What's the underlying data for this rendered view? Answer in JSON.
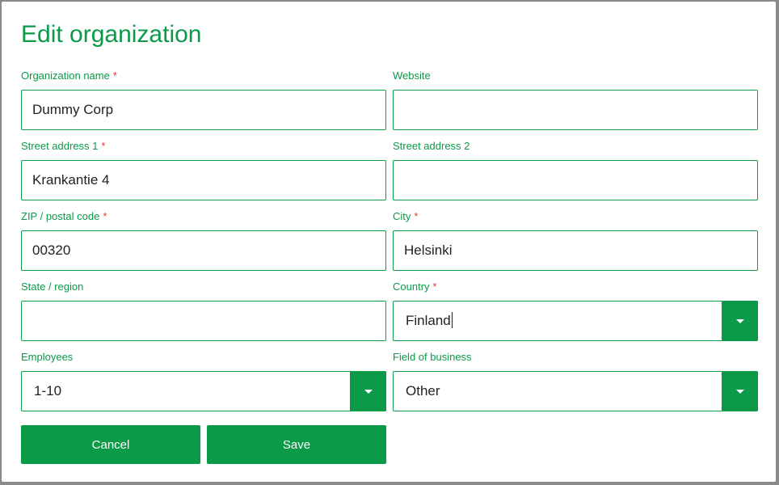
{
  "dialog": {
    "title": "Edit organization"
  },
  "form": {
    "required_mark": "*",
    "org_name": {
      "label": "Organization name",
      "value": "Dummy Corp"
    },
    "website": {
      "label": "Website",
      "value": ""
    },
    "street1": {
      "label": "Street address 1",
      "value": "Krankantie 4"
    },
    "street2": {
      "label": "Street address 2",
      "value": ""
    },
    "zip": {
      "label": "ZIP / postal code",
      "value": "00320"
    },
    "city": {
      "label": "City",
      "value": "Helsinki"
    },
    "state": {
      "label": "State / region",
      "value": ""
    },
    "country": {
      "label": "Country",
      "value": "Finland"
    },
    "employees": {
      "label": "Employees",
      "value": "1-10"
    },
    "field_of_business": {
      "label": "Field of business",
      "value": "Other"
    }
  },
  "actions": {
    "cancel_label": "Cancel",
    "save_label": "Save"
  },
  "icons": {
    "dropdown": "chevron-down-icon"
  },
  "colors": {
    "accent": "#0a9a48",
    "required": "#e53935",
    "backdrop": "#8a8a8a"
  }
}
